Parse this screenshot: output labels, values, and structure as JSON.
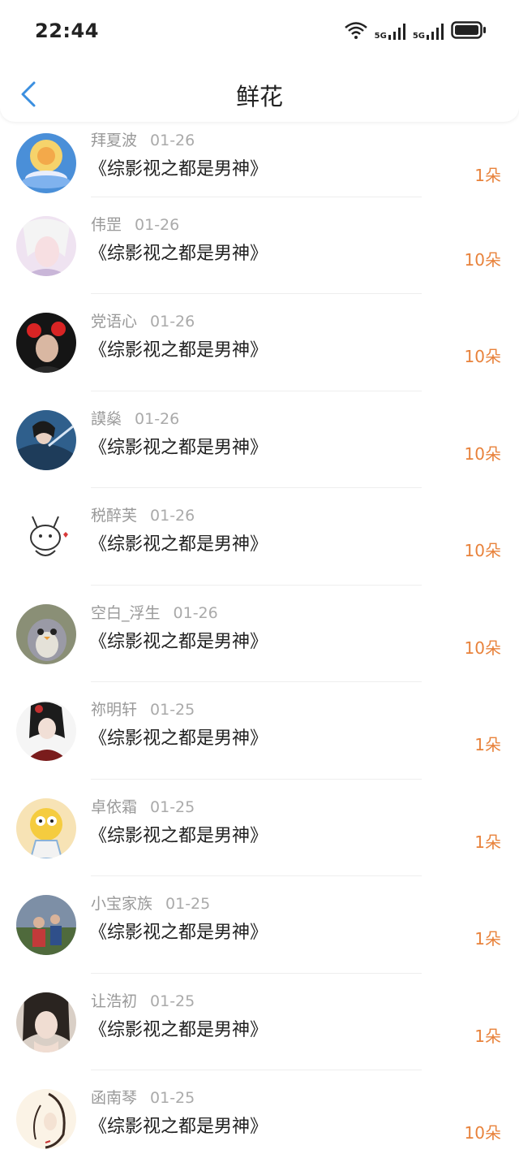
{
  "status": {
    "time": "22:44",
    "net1": "5G",
    "net2": "5G"
  },
  "nav": {
    "title": "鲜花"
  },
  "colors": {
    "accent": "#e8823b",
    "back": "#3b8fe0"
  },
  "items": [
    {
      "user": "拜夏波",
      "date": "01-26",
      "book": "《综影视之都是男神》",
      "count": "1朵",
      "avatar": "buddha-lotus"
    },
    {
      "user": "伟罡",
      "date": "01-26",
      "book": "《综影视之都是男神》",
      "count": "10朵",
      "avatar": "anime-white-hair"
    },
    {
      "user": "党语心",
      "date": "01-26",
      "book": "《综影视之都是男神》",
      "count": "10朵",
      "avatar": "person-dark"
    },
    {
      "user": "謨燊",
      "date": "01-26",
      "book": "《综影视之都是男神》",
      "count": "10朵",
      "avatar": "anime-swordsman"
    },
    {
      "user": "税醉芙",
      "date": "01-26",
      "book": "《综影视之都是男神》",
      "count": "10朵",
      "avatar": "doodle-bunny"
    },
    {
      "user": "空白_浮生",
      "date": "01-26",
      "book": "《综影视之都是男神》",
      "count": "10朵",
      "avatar": "plush-penguin"
    },
    {
      "user": "祢明轩",
      "date": "01-25",
      "book": "《综影视之都是男神》",
      "count": "1朵",
      "avatar": "anime-girl-red"
    },
    {
      "user": "卓依霜",
      "date": "01-25",
      "book": "《综影视之都是男神》",
      "count": "1朵",
      "avatar": "cartoon-yellow"
    },
    {
      "user": "小宝家族",
      "date": "01-25",
      "book": "《综影视之都是男神》",
      "count": "1朵",
      "avatar": "family-photo"
    },
    {
      "user": "让浩初",
      "date": "01-25",
      "book": "《综影视之都是男神》",
      "count": "1朵",
      "avatar": "anime-girl-dark"
    },
    {
      "user": "函南琴",
      "date": "01-25",
      "book": "《综影视之都是男神》",
      "count": "10朵",
      "avatar": "sketch-girl"
    }
  ]
}
